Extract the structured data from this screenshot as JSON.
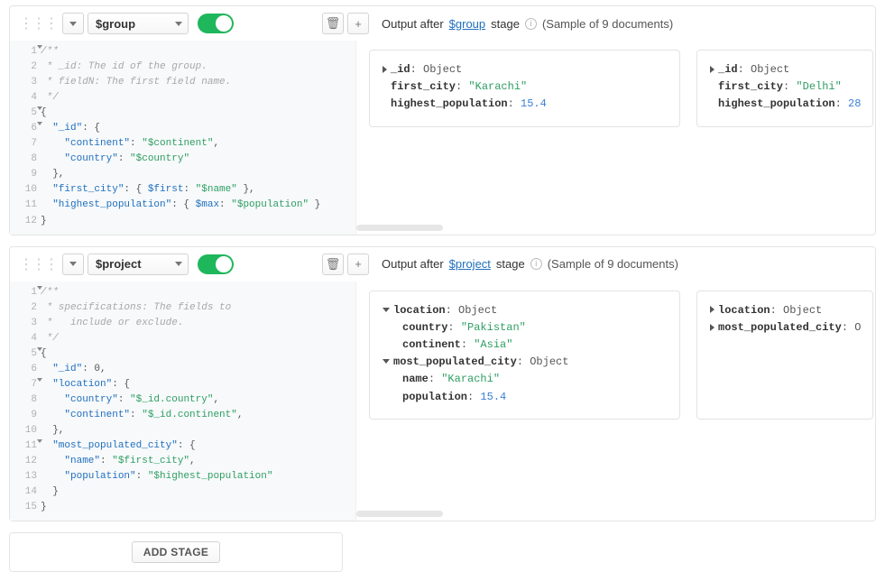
{
  "stages": [
    {
      "operator": "$group",
      "enabled": true,
      "output_header": {
        "prefix": "Output after ",
        "link": "$group",
        "suffix": " stage",
        "sample": "(Sample of 9 documents)"
      },
      "code_lines": [
        {
          "n": 1,
          "fold": true,
          "segments": [
            {
              "cls": "tok-comment",
              "t": "/**"
            }
          ]
        },
        {
          "n": 2,
          "fold": false,
          "segments": [
            {
              "cls": "tok-comment",
              "t": " * _id: The id of the group."
            }
          ]
        },
        {
          "n": 3,
          "fold": false,
          "segments": [
            {
              "cls": "tok-comment",
              "t": " * fieldN: The first field name."
            }
          ]
        },
        {
          "n": 4,
          "fold": false,
          "segments": [
            {
              "cls": "tok-comment",
              "t": " */"
            }
          ]
        },
        {
          "n": 5,
          "fold": true,
          "segments": [
            {
              "cls": "tok-punct",
              "t": "{"
            }
          ]
        },
        {
          "n": 6,
          "fold": true,
          "segments": [
            {
              "cls": "tok-punct",
              "t": "  "
            },
            {
              "cls": "tok-key",
              "t": "\"_id\""
            },
            {
              "cls": "tok-punct",
              "t": ": {"
            }
          ]
        },
        {
          "n": 7,
          "fold": false,
          "segments": [
            {
              "cls": "tok-punct",
              "t": "    "
            },
            {
              "cls": "tok-key",
              "t": "\"continent\""
            },
            {
              "cls": "tok-punct",
              "t": ": "
            },
            {
              "cls": "tok-str",
              "t": "\"$continent\""
            },
            {
              "cls": "tok-punct",
              "t": ","
            }
          ]
        },
        {
          "n": 8,
          "fold": false,
          "segments": [
            {
              "cls": "tok-punct",
              "t": "    "
            },
            {
              "cls": "tok-key",
              "t": "\"country\""
            },
            {
              "cls": "tok-punct",
              "t": ": "
            },
            {
              "cls": "tok-str",
              "t": "\"$country\""
            }
          ]
        },
        {
          "n": 9,
          "fold": false,
          "segments": [
            {
              "cls": "tok-punct",
              "t": "  },"
            }
          ]
        },
        {
          "n": 10,
          "fold": false,
          "segments": [
            {
              "cls": "tok-punct",
              "t": "  "
            },
            {
              "cls": "tok-key",
              "t": "\"first_city\""
            },
            {
              "cls": "tok-punct",
              "t": ": { "
            },
            {
              "cls": "tok-key",
              "t": "$first"
            },
            {
              "cls": "tok-punct",
              "t": ": "
            },
            {
              "cls": "tok-str",
              "t": "\"$name\""
            },
            {
              "cls": "tok-punct",
              "t": " },"
            }
          ]
        },
        {
          "n": 11,
          "fold": false,
          "segments": [
            {
              "cls": "tok-punct",
              "t": "  "
            },
            {
              "cls": "tok-key",
              "t": "\"highest_population\""
            },
            {
              "cls": "tok-punct",
              "t": ": { "
            },
            {
              "cls": "tok-key",
              "t": "$max"
            },
            {
              "cls": "tok-punct",
              "t": ": "
            },
            {
              "cls": "tok-str",
              "t": "\"$population\""
            },
            {
              "cls": "tok-punct",
              "t": " }"
            }
          ]
        },
        {
          "n": 12,
          "fold": false,
          "segments": [
            {
              "cls": "tok-punct",
              "t": "}"
            }
          ]
        }
      ],
      "docs": [
        {
          "lines": [
            {
              "indent": 0,
              "tri": "right",
              "field": "_id",
              "vtype": "Object"
            },
            {
              "indent": 0,
              "tri": "",
              "field": "first_city",
              "vstr": "\"Karachi\""
            },
            {
              "indent": 0,
              "tri": "",
              "field": "highest_population",
              "vnum": "15.4"
            }
          ]
        },
        {
          "cut": true,
          "lines": [
            {
              "indent": 0,
              "tri": "right",
              "field": "_id",
              "vtype": "Object"
            },
            {
              "indent": 0,
              "tri": "",
              "field": "first_city",
              "vstr": "\"Delhi\""
            },
            {
              "indent": 0,
              "tri": "",
              "field": "highest_population",
              "vnum": "28"
            }
          ]
        }
      ]
    },
    {
      "operator": "$project",
      "enabled": true,
      "output_header": {
        "prefix": "Output after ",
        "link": "$project",
        "suffix": " stage",
        "sample": "(Sample of 9 documents)"
      },
      "code_lines": [
        {
          "n": 1,
          "fold": true,
          "segments": [
            {
              "cls": "tok-comment",
              "t": "/**"
            }
          ]
        },
        {
          "n": 2,
          "fold": false,
          "segments": [
            {
              "cls": "tok-comment",
              "t": " * specifications: The fields to"
            }
          ]
        },
        {
          "n": 3,
          "fold": false,
          "segments": [
            {
              "cls": "tok-comment",
              "t": " *   include or exclude."
            }
          ]
        },
        {
          "n": 4,
          "fold": false,
          "segments": [
            {
              "cls": "tok-comment",
              "t": " */"
            }
          ]
        },
        {
          "n": 5,
          "fold": true,
          "segments": [
            {
              "cls": "tok-punct",
              "t": "{"
            }
          ]
        },
        {
          "n": 6,
          "fold": false,
          "segments": [
            {
              "cls": "tok-punct",
              "t": "  "
            },
            {
              "cls": "tok-key",
              "t": "\"_id\""
            },
            {
              "cls": "tok-punct",
              "t": ": "
            },
            {
              "cls": "tok-punct",
              "t": "0,"
            }
          ]
        },
        {
          "n": 7,
          "fold": true,
          "segments": [
            {
              "cls": "tok-punct",
              "t": "  "
            },
            {
              "cls": "tok-key",
              "t": "\"location\""
            },
            {
              "cls": "tok-punct",
              "t": ": {"
            }
          ]
        },
        {
          "n": 8,
          "fold": false,
          "segments": [
            {
              "cls": "tok-punct",
              "t": "    "
            },
            {
              "cls": "tok-key",
              "t": "\"country\""
            },
            {
              "cls": "tok-punct",
              "t": ": "
            },
            {
              "cls": "tok-str",
              "t": "\"$_id.country\""
            },
            {
              "cls": "tok-punct",
              "t": ","
            }
          ]
        },
        {
          "n": 9,
          "fold": false,
          "segments": [
            {
              "cls": "tok-punct",
              "t": "    "
            },
            {
              "cls": "tok-key",
              "t": "\"continent\""
            },
            {
              "cls": "tok-punct",
              "t": ": "
            },
            {
              "cls": "tok-str",
              "t": "\"$_id.continent\""
            },
            {
              "cls": "tok-punct",
              "t": ","
            }
          ]
        },
        {
          "n": 10,
          "fold": false,
          "segments": [
            {
              "cls": "tok-punct",
              "t": "  },"
            }
          ]
        },
        {
          "n": 11,
          "fold": true,
          "segments": [
            {
              "cls": "tok-punct",
              "t": "  "
            },
            {
              "cls": "tok-key",
              "t": "\"most_populated_city\""
            },
            {
              "cls": "tok-punct",
              "t": ": {"
            }
          ]
        },
        {
          "n": 12,
          "fold": false,
          "segments": [
            {
              "cls": "tok-punct",
              "t": "    "
            },
            {
              "cls": "tok-key",
              "t": "\"name\""
            },
            {
              "cls": "tok-punct",
              "t": ": "
            },
            {
              "cls": "tok-str",
              "t": "\"$first_city\""
            },
            {
              "cls": "tok-punct",
              "t": ","
            }
          ]
        },
        {
          "n": 13,
          "fold": false,
          "segments": [
            {
              "cls": "tok-punct",
              "t": "    "
            },
            {
              "cls": "tok-key",
              "t": "\"population\""
            },
            {
              "cls": "tok-punct",
              "t": ": "
            },
            {
              "cls": "tok-str",
              "t": "\"$highest_population\""
            }
          ]
        },
        {
          "n": 14,
          "fold": false,
          "segments": [
            {
              "cls": "tok-punct",
              "t": "  }"
            }
          ]
        },
        {
          "n": 15,
          "fold": false,
          "segments": [
            {
              "cls": "tok-punct",
              "t": "}"
            }
          ]
        }
      ],
      "docs": [
        {
          "lines": [
            {
              "indent": 0,
              "tri": "down",
              "field": "location",
              "vtype": "Object"
            },
            {
              "indent": 1,
              "tri": "",
              "field": "country",
              "vstr": "\"Pakistan\""
            },
            {
              "indent": 1,
              "tri": "",
              "field": "continent",
              "vstr": "\"Asia\""
            },
            {
              "indent": 0,
              "tri": "down",
              "field": "most_populated_city",
              "vtype": "Object"
            },
            {
              "indent": 1,
              "tri": "",
              "field": "name",
              "vstr": "\"Karachi\""
            },
            {
              "indent": 1,
              "tri": "",
              "field": "population",
              "vnum": "15.4"
            }
          ]
        },
        {
          "cut": true,
          "lines": [
            {
              "indent": 0,
              "tri": "right",
              "field": "location",
              "vtype": "Object"
            },
            {
              "indent": 0,
              "tri": "right",
              "field": "most_populated_city",
              "vtype": "O"
            }
          ]
        }
      ]
    }
  ],
  "add_stage_label": "ADD STAGE"
}
